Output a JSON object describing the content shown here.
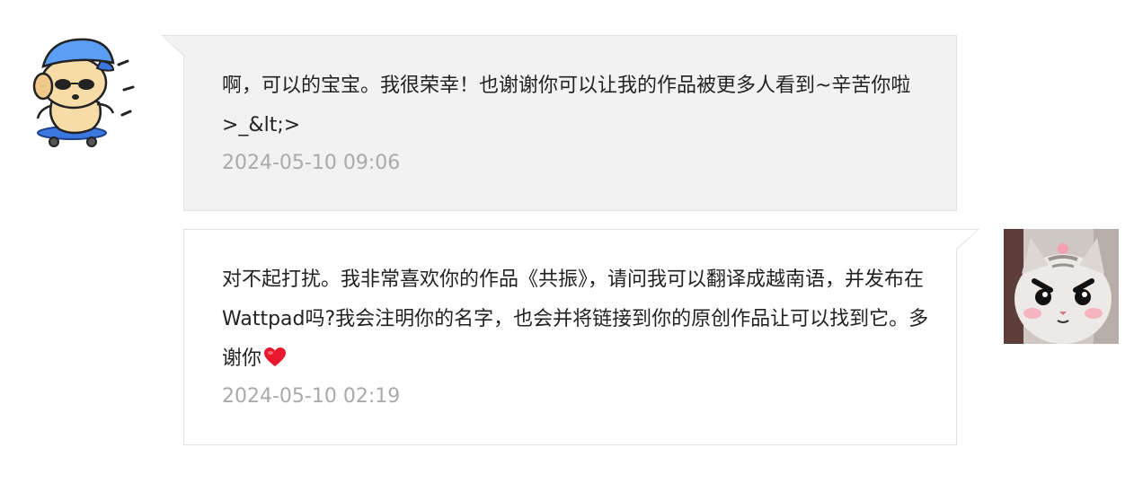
{
  "messages": [
    {
      "direction": "received",
      "avatar": "cartoon-dog-on-skateboard-icon",
      "text": "啊，可以的宝宝。我很荣幸！也谢谢你可以让我的作品被更多人看到~辛苦你啦>_&lt;>",
      "time": "2024-05-10 09:06"
    },
    {
      "direction": "sent",
      "avatar": "grumpy-cat-photo-icon",
      "text": "对不起打扰。我非常喜欢你的作品《共振》，请问我可以翻译成越南语，并发布在Wattpad吗?我会注明你的名字，也会并将链接到你的原创作品让可以找到它。多谢你",
      "emoji": "heart-icon",
      "time": "2024-05-10 02:19"
    }
  ],
  "colors": {
    "received_bubble": "#f2f2f2",
    "sent_bubble": "#ffffff",
    "border": "#e3e3e3",
    "text": "#222222",
    "timestamp": "#aaaaaa",
    "heart": "#e8192c"
  }
}
